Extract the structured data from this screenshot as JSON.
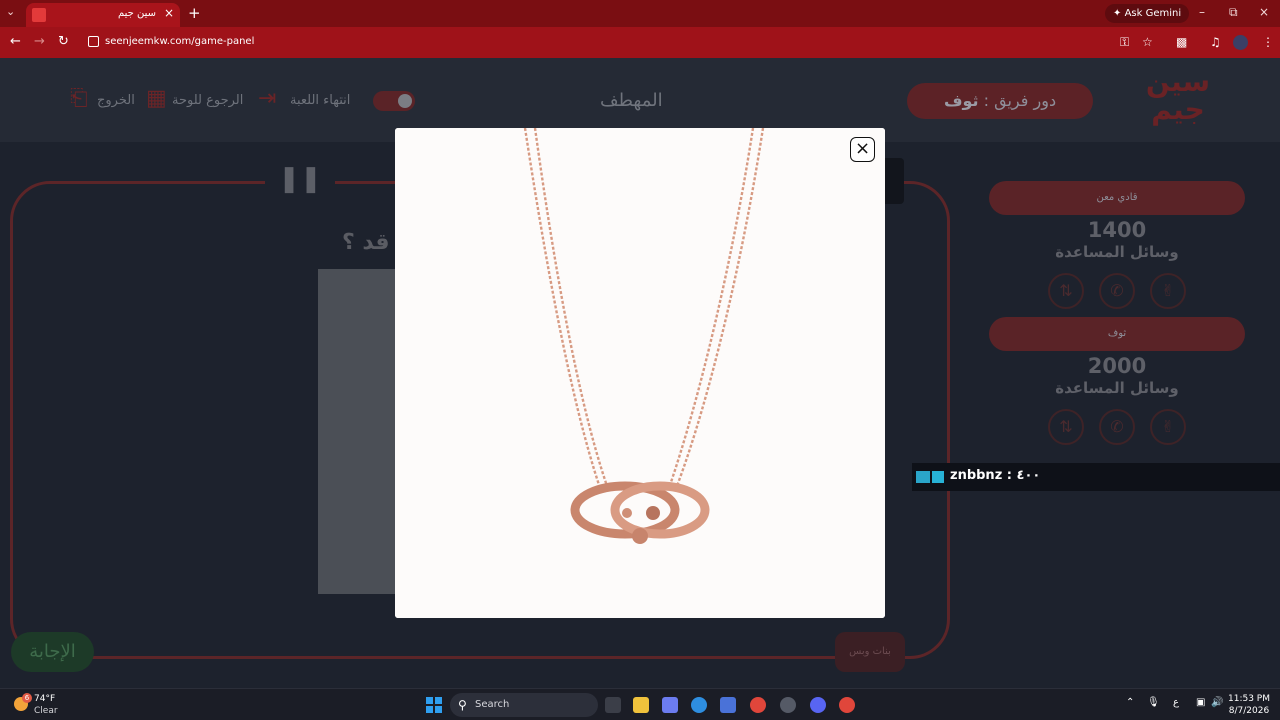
{
  "browser": {
    "tab_title": "سين جيم",
    "ask_gemini": "Ask Gemini",
    "url": "seenjeemkw.com/game-panel"
  },
  "header": {
    "logo_text": "سين جيم",
    "team_turn_prefix": "دور فريق : ",
    "team_turn_name": "ثوف",
    "category": "المهطف",
    "end_game": "انتهاء اللعبة",
    "back_to_board": "الرجوع للوحة",
    "exit": "الخروج"
  },
  "board": {
    "question": "قد ؟",
    "answer_button": "الإجابة",
    "subteam_button": "بنات وبس"
  },
  "teams": [
    {
      "name": "قادي معن",
      "score": "1400",
      "help_label": "وسائل المساعدة"
    },
    {
      "name": "ثوف",
      "score": "2000",
      "help_label": "وسائل المساعدة"
    }
  ],
  "chat": {
    "text": "znbbnz : ٤٠٠"
  },
  "modal": {
    "image_alt": "rose gold double-chain necklace with interlocking link pendant"
  },
  "taskbar": {
    "weather_temp": "74°F",
    "weather_desc": "Clear",
    "weather_badge": "6",
    "search_label": "Search",
    "lang": "ع",
    "time": "11:53 PM",
    "date": "8/7/2026"
  },
  "colors": {
    "chrome_red": "#9f1219",
    "accent_dark_red": "#5a2327",
    "page_bg": "#1d222d"
  }
}
